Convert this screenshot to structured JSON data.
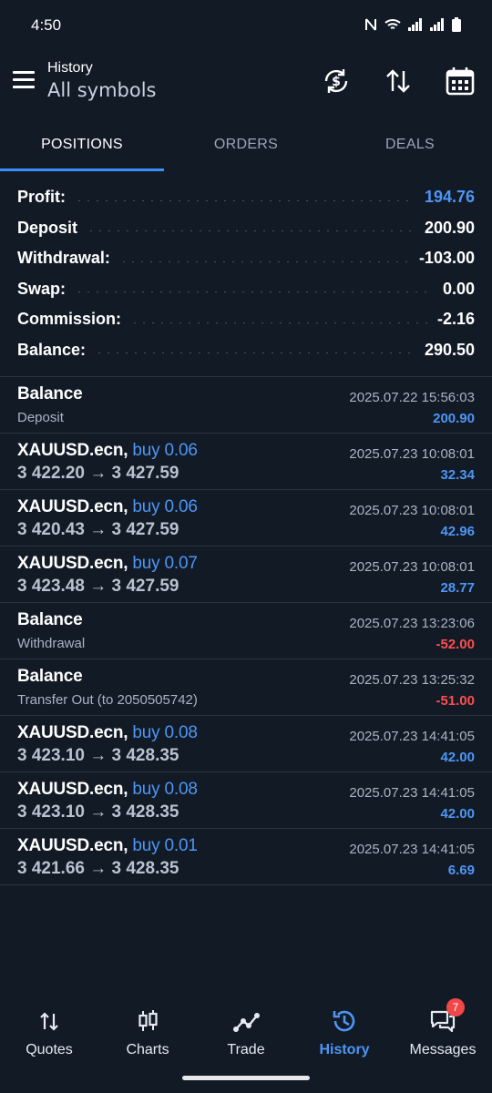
{
  "status_bar": {
    "time": "4:50"
  },
  "header": {
    "title": "History",
    "subtitle": "All symbols"
  },
  "tabs": [
    {
      "label": "POSITIONS",
      "active": true
    },
    {
      "label": "ORDERS",
      "active": false
    },
    {
      "label": "DEALS",
      "active": false
    }
  ],
  "summary": {
    "profit": {
      "label": "Profit:",
      "value": "194.76"
    },
    "deposit": {
      "label": "Deposit",
      "value": "200.90"
    },
    "withdrawal": {
      "label": "Withdrawal:",
      "value": "-103.00"
    },
    "swap": {
      "label": "Swap:",
      "value": "0.00"
    },
    "commission": {
      "label": "Commission:",
      "value": "-2.16"
    },
    "balance": {
      "label": "Balance:",
      "value": "290.50"
    }
  },
  "items": [
    {
      "title": "Balance",
      "side": "",
      "sub": "Deposit",
      "time": "2025.07.22 15:56:03",
      "amount": "200.90"
    },
    {
      "title": "XAUUSD.ecn,",
      "side": "buy 0.06",
      "sub": "3 422.20 → 3 427.59",
      "time": "2025.07.23 10:08:01",
      "amount": "32.34"
    },
    {
      "title": "XAUUSD.ecn,",
      "side": "buy 0.06",
      "sub": "3 420.43 → 3 427.59",
      "time": "2025.07.23 10:08:01",
      "amount": "42.96"
    },
    {
      "title": "XAUUSD.ecn,",
      "side": "buy 0.07",
      "sub": "3 423.48 → 3 427.59",
      "time": "2025.07.23 10:08:01",
      "amount": "28.77"
    },
    {
      "title": "Balance",
      "side": "",
      "sub": "Withdrawal",
      "time": "2025.07.23 13:23:06",
      "amount": "-52.00"
    },
    {
      "title": "Balance",
      "side": "",
      "sub": "Transfer Out (to 2050505742)",
      "time": "2025.07.23 13:25:32",
      "amount": "-51.00"
    },
    {
      "title": "XAUUSD.ecn,",
      "side": "buy 0.08",
      "sub": "3 423.10 → 3 428.35",
      "time": "2025.07.23 14:41:05",
      "amount": "42.00"
    },
    {
      "title": "XAUUSD.ecn,",
      "side": "buy 0.08",
      "sub": "3 423.10 → 3 428.35",
      "time": "2025.07.23 14:41:05",
      "amount": "42.00"
    },
    {
      "title": "XAUUSD.ecn,",
      "side": "buy 0.01",
      "sub": "3 421.66 → 3 428.35",
      "time": "2025.07.23 14:41:05",
      "amount": "6.69"
    }
  ],
  "bottom_nav": {
    "quotes": "Quotes",
    "charts": "Charts",
    "trade": "Trade",
    "history": "History",
    "messages": "Messages",
    "messages_badge": "7"
  },
  "colors": {
    "background": "#121a26",
    "accent": "#4d96f5",
    "negative": "#ff4d4d"
  }
}
